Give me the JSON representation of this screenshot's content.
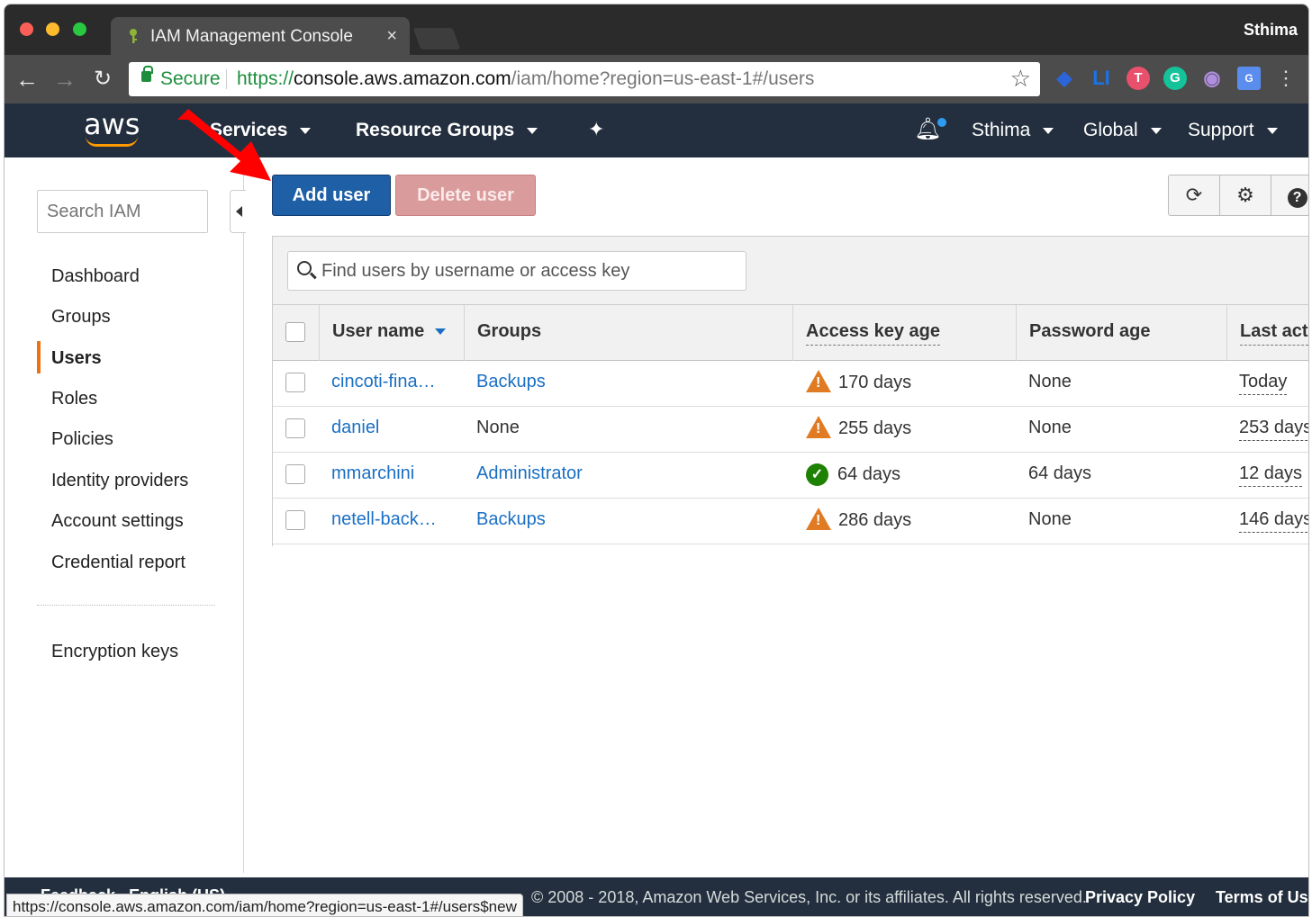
{
  "browser": {
    "tab_title": "IAM Management Console",
    "tab_close": "×",
    "profile_name": "Sthima",
    "secure_label": "Secure",
    "url_scheme": "https://",
    "url_host": "console.aws.amazon.com",
    "url_path": "/iam/home?region=us-east-1#/users",
    "status_url": "https://console.aws.amazon.com/iam/home?region=us-east-1#/users$new",
    "extensions": [
      "LI",
      "T",
      "G",
      "G"
    ]
  },
  "aws_nav": {
    "logo": "aws",
    "services": "Services",
    "resource_groups": "Resource Groups",
    "account": "Sthima",
    "region": "Global",
    "support": "Support"
  },
  "sidebar": {
    "search_placeholder": "Search IAM",
    "items": [
      {
        "label": "Dashboard"
      },
      {
        "label": "Groups"
      },
      {
        "label": "Users",
        "active": true
      },
      {
        "label": "Roles"
      },
      {
        "label": "Policies"
      },
      {
        "label": "Identity providers"
      },
      {
        "label": "Account settings"
      },
      {
        "label": "Credential report"
      }
    ],
    "extra_item": "Encryption keys"
  },
  "toolbar": {
    "add_user": "Add user",
    "delete_user": "Delete user"
  },
  "users_table": {
    "search_placeholder": "Find users by username or access key",
    "columns": [
      "User name",
      "Groups",
      "Access key age",
      "Password age",
      "Last act"
    ],
    "rows": [
      {
        "user": "cincoti-fina…",
        "groups": "Backups",
        "groups_link": true,
        "key_age": "170 days",
        "key_status": "warning",
        "password_age": "None",
        "last_activity": "Today"
      },
      {
        "user": "daniel",
        "groups": "None",
        "groups_link": false,
        "key_age": "255 days",
        "key_status": "warning",
        "password_age": "None",
        "last_activity": "253 days"
      },
      {
        "user": "mmarchini",
        "groups": "Administrator",
        "groups_link": true,
        "key_age": "64 days",
        "key_status": "ok",
        "password_age": "64 days",
        "last_activity": "12 days"
      },
      {
        "user": "netell-back…",
        "groups": "Backups",
        "groups_link": true,
        "key_age": "286 days",
        "key_status": "warning",
        "password_age": "None",
        "last_activity": "146 days"
      }
    ]
  },
  "footer": {
    "feedback": "Feedback",
    "language": "English (US)",
    "copyright": "© 2008 - 2018, Amazon Web Services, Inc. or its affiliates. All rights reserved.",
    "privacy": "Privacy Policy",
    "terms": "Terms of Use"
  },
  "colors": {
    "aws_nav_bg": "#232f3e",
    "primary_button": "#1f5fa6",
    "link": "#1a6fc4",
    "warning": "#e07b23",
    "ok": "#1d8102",
    "active_marker": "#ec7211",
    "annotation_arrow": "#ff0000"
  }
}
